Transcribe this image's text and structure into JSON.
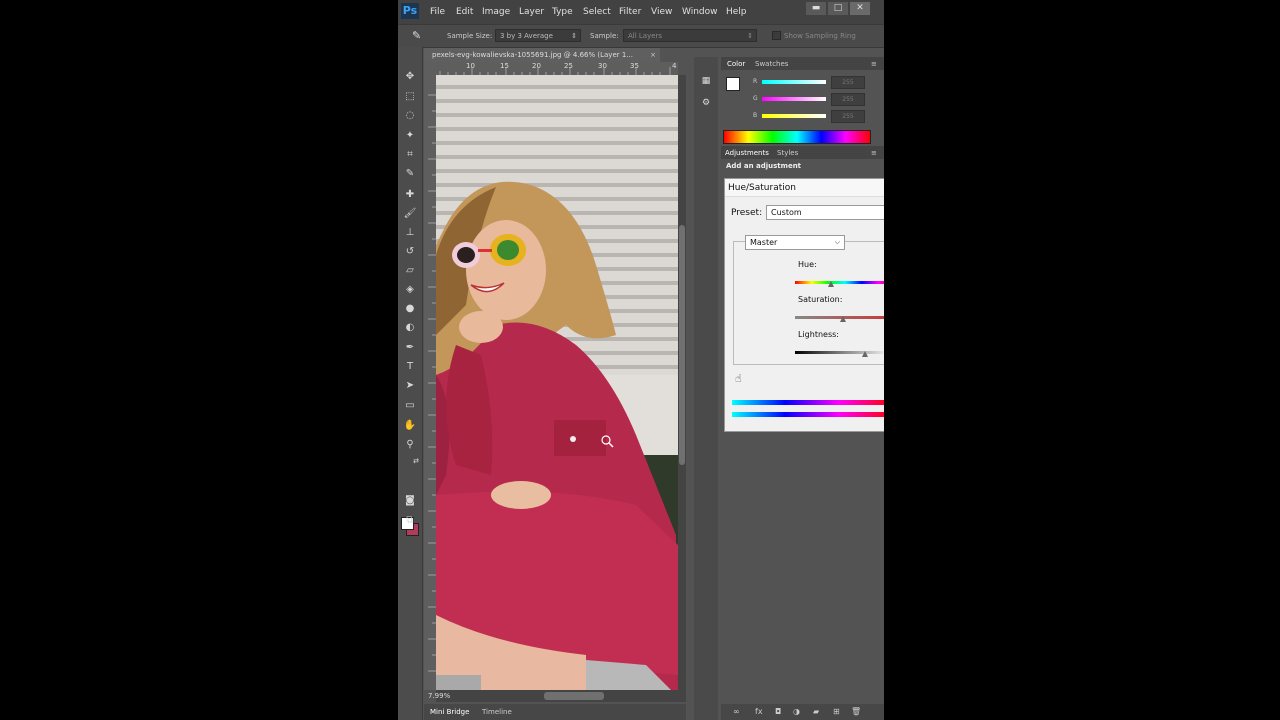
{
  "app": {
    "logo": "Ps"
  },
  "menu": [
    "File",
    "Edit",
    "Image",
    "Layer",
    "Type",
    "Select",
    "Filter",
    "View",
    "Window",
    "Help"
  ],
  "window_controls": {
    "minimize": "▬",
    "maximize": "□",
    "close": "✕"
  },
  "options": {
    "sample_size_label": "Sample Size:",
    "sample_size_value": "3 by 3 Average",
    "sample_label": "Sample:",
    "sample_value": "All Layers",
    "show_ring_label": "Show Sampling Ring"
  },
  "document": {
    "tab_title": "pexels-evg-kowalievska-1055691.jpg @ 4.66% (Layer 1...",
    "close": "×",
    "ruler_ticks": [
      "10",
      "15",
      "20",
      "25",
      "30",
      "35",
      "4"
    ],
    "zoom": "7.99%"
  },
  "bottom_tabs": [
    "Mini Bridge",
    "Timeline"
  ],
  "color_panel": {
    "tabs": [
      "Color",
      "Swatches"
    ],
    "channels": [
      {
        "label": "R",
        "value": "255",
        "level": 1.0
      },
      {
        "label": "G",
        "value": "255",
        "level": 1.0
      },
      {
        "label": "B",
        "value": "255",
        "level": 1.0
      }
    ]
  },
  "adjustments_panel": {
    "tabs": [
      "Adjustments",
      "Styles"
    ],
    "heading": "Add an adjustment"
  },
  "hue_sat_dialog": {
    "title": "Hue/Saturation",
    "preset_label": "Preset:",
    "preset_value": "Custom",
    "channel_value": "Master",
    "hue_label": "Hue:",
    "saturation_label": "Saturation:",
    "lightness_label": "Lightness:"
  },
  "colors": {
    "dress": "#b5294c",
    "wall": "#d9d6d2",
    "hair": "#c69a5c"
  }
}
